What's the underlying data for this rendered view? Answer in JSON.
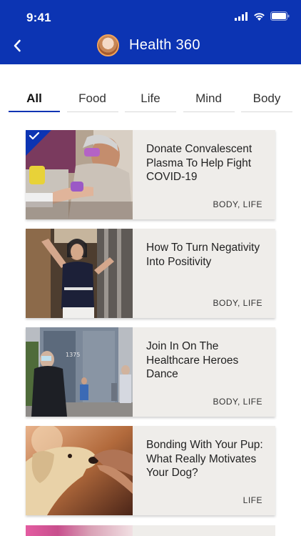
{
  "status_bar": {
    "time": "9:41"
  },
  "header": {
    "title": "Health 360"
  },
  "tabs": [
    {
      "label": "All",
      "active": true
    },
    {
      "label": "Food",
      "active": false
    },
    {
      "label": "Life",
      "active": false
    },
    {
      "label": "Mind",
      "active": false
    },
    {
      "label": "Body",
      "active": false
    }
  ],
  "articles": [
    {
      "title": "Donate Convalescent Plasma To Help Fight COVID-19",
      "tags": "BODY, LIFE",
      "checked": true
    },
    {
      "title": "How To Turn Negativity Into Positivity",
      "tags": "BODY, LIFE",
      "checked": false
    },
    {
      "title": "Join In On The Healthcare Heroes Dance",
      "tags": "BODY, LIFE",
      "checked": false
    },
    {
      "title": "Bonding With Your Pup: What Really Motivates Your Dog?",
      "tags": "LIFE",
      "checked": false
    }
  ],
  "colors": {
    "brand": "#0c34b3",
    "card_bg": "#efedea"
  }
}
